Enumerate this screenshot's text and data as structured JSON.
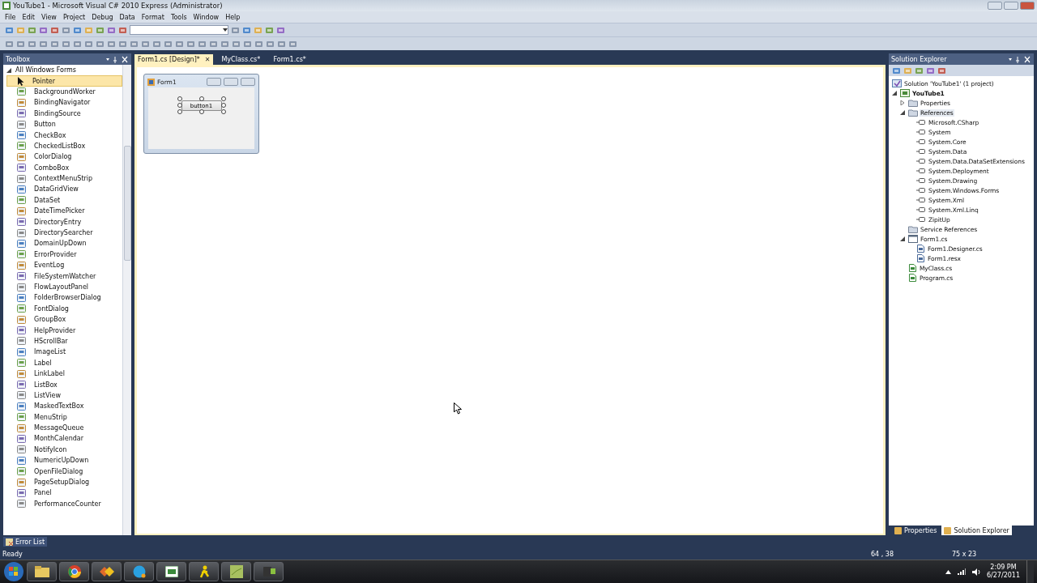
{
  "window": {
    "title": "YouTube1 - Microsoft Visual C# 2010 Express (Administrator)"
  },
  "menu": [
    "File",
    "Edit",
    "View",
    "Project",
    "Debug",
    "Data",
    "Format",
    "Tools",
    "Window",
    "Help"
  ],
  "toolbox": {
    "title": "Toolbox",
    "group": {
      "label": "All Windows Forms",
      "expanded": true
    },
    "items": [
      {
        "label": "Pointer",
        "selected": true
      },
      {
        "label": "BackgroundWorker",
        "selected": false
      },
      {
        "label": "BindingNavigator",
        "selected": false
      },
      {
        "label": "BindingSource",
        "selected": false
      },
      {
        "label": "Button",
        "selected": false
      },
      {
        "label": "CheckBox",
        "selected": false
      },
      {
        "label": "CheckedListBox",
        "selected": false
      },
      {
        "label": "ColorDialog",
        "selected": false
      },
      {
        "label": "ComboBox",
        "selected": false
      },
      {
        "label": "ContextMenuStrip",
        "selected": false
      },
      {
        "label": "DataGridView",
        "selected": false
      },
      {
        "label": "DataSet",
        "selected": false
      },
      {
        "label": "DateTimePicker",
        "selected": false
      },
      {
        "label": "DirectoryEntry",
        "selected": false
      },
      {
        "label": "DirectorySearcher",
        "selected": false
      },
      {
        "label": "DomainUpDown",
        "selected": false
      },
      {
        "label": "ErrorProvider",
        "selected": false
      },
      {
        "label": "EventLog",
        "selected": false
      },
      {
        "label": "FileSystemWatcher",
        "selected": false
      },
      {
        "label": "FlowLayoutPanel",
        "selected": false
      },
      {
        "label": "FolderBrowserDialog",
        "selected": false
      },
      {
        "label": "FontDialog",
        "selected": false
      },
      {
        "label": "GroupBox",
        "selected": false
      },
      {
        "label": "HelpProvider",
        "selected": false
      },
      {
        "label": "HScrollBar",
        "selected": false
      },
      {
        "label": "ImageList",
        "selected": false
      },
      {
        "label": "Label",
        "selected": false
      },
      {
        "label": "LinkLabel",
        "selected": false
      },
      {
        "label": "ListBox",
        "selected": false
      },
      {
        "label": "ListView",
        "selected": false
      },
      {
        "label": "MaskedTextBox",
        "selected": false
      },
      {
        "label": "MenuStrip",
        "selected": false
      },
      {
        "label": "MessageQueue",
        "selected": false
      },
      {
        "label": "MonthCalendar",
        "selected": false
      },
      {
        "label": "NotifyIcon",
        "selected": false
      },
      {
        "label": "NumericUpDown",
        "selected": false
      },
      {
        "label": "OpenFileDialog",
        "selected": false
      },
      {
        "label": "PageSetupDialog",
        "selected": false
      },
      {
        "label": "Panel",
        "selected": false
      },
      {
        "label": "PerformanceCounter",
        "selected": false
      }
    ]
  },
  "document_tabs": [
    {
      "label": "Form1.cs [Design]*",
      "selected": true,
      "close": "✕"
    },
    {
      "label": "MyClass.cs*",
      "selected": false
    },
    {
      "label": "Form1.cs*",
      "selected": false
    }
  ],
  "designer": {
    "form": {
      "title": "Form1",
      "button": "button1"
    }
  },
  "solution_explorer": {
    "title": "Solution Explorer",
    "tree": [
      {
        "label": "Solution 'YouTube1' (1 project)",
        "kind": "solution",
        "selected": false,
        "children": [
          {
            "label": "YouTube1",
            "kind": "project",
            "expanded": true,
            "selected": false,
            "children": [
              {
                "label": "Properties",
                "kind": "folder",
                "expanded": false,
                "selected": false
              },
              {
                "label": "References",
                "kind": "folder",
                "expanded": true,
                "selected": true,
                "children": [
                  {
                    "label": "Microsoft.CSharp",
                    "kind": "reference",
                    "selected": false
                  },
                  {
                    "label": "System",
                    "kind": "reference",
                    "selected": false
                  },
                  {
                    "label": "System.Core",
                    "kind": "reference",
                    "selected": false
                  },
                  {
                    "label": "System.Data",
                    "kind": "reference",
                    "selected": false
                  },
                  {
                    "label": "System.Data.DataSetExtensions",
                    "kind": "reference",
                    "selected": false
                  },
                  {
                    "label": "System.Deployment",
                    "kind": "reference",
                    "selected": false
                  },
                  {
                    "label": "System.Drawing",
                    "kind": "reference",
                    "selected": false
                  },
                  {
                    "label": "System.Windows.Forms",
                    "kind": "reference",
                    "selected": false
                  },
                  {
                    "label": "System.Xml",
                    "kind": "reference",
                    "selected": false
                  },
                  {
                    "label": "System.Xml.Linq",
                    "kind": "reference",
                    "selected": false
                  },
                  {
                    "label": "ZipitUp",
                    "kind": "reference",
                    "selected": false
                  }
                ]
              },
              {
                "label": "Service References",
                "kind": "folder",
                "selected": false
              },
              {
                "label": "Form1.cs",
                "kind": "form",
                "expanded": true,
                "selected": false,
                "children": [
                  {
                    "label": "Form1.Designer.cs",
                    "kind": "file",
                    "selected": false
                  },
                  {
                    "label": "Form1.resx",
                    "kind": "file",
                    "selected": false
                  }
                ]
              },
              {
                "label": "MyClass.cs",
                "kind": "code",
                "selected": false
              },
              {
                "label": "Program.cs",
                "kind": "code",
                "selected": false
              }
            ]
          }
        ]
      }
    ]
  },
  "side_tabs": [
    {
      "label": "Properties",
      "selected": false
    },
    {
      "label": "Solution Explorer",
      "selected": true
    }
  ],
  "bottom_tabs": [
    {
      "label": "Error List"
    }
  ],
  "status_bar": {
    "text": "Ready",
    "position": "64 , 38",
    "size": "75 x 23"
  },
  "taskbar": {
    "time": "2:09 PM",
    "date": "6/27/2011"
  }
}
